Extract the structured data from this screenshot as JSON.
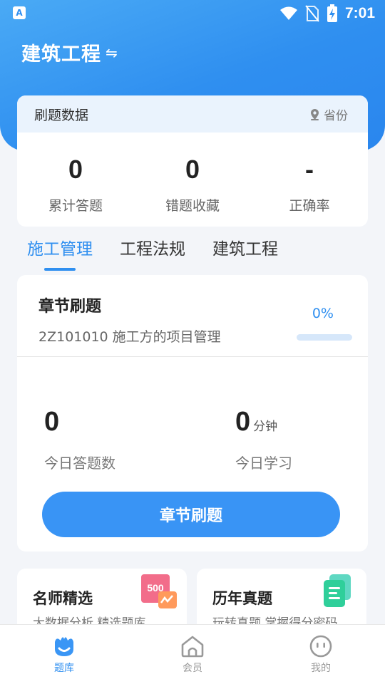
{
  "status_bar": {
    "time": "7:01",
    "app_icon_letter": "A"
  },
  "header": {
    "title": "建筑工程",
    "switch_icon": "swap-arrows-icon"
  },
  "stats": {
    "title": "刷题数据",
    "province_label": "省份",
    "items": [
      {
        "value": "0",
        "label": "累计答题"
      },
      {
        "value": "0",
        "label": "错题收藏"
      },
      {
        "value": "-",
        "label": "正确率"
      }
    ]
  },
  "tabs": [
    {
      "label": "施工管理",
      "active": true
    },
    {
      "label": "工程法规",
      "active": false
    },
    {
      "label": "建筑工程",
      "active": false
    }
  ],
  "chapter": {
    "title": "章节刷题",
    "subtitle": "2Z101010 施工方的项目管理",
    "progress_text": "0%",
    "progress": 0,
    "today_count": "0",
    "today_count_label": "今日答题数",
    "today_study": "0",
    "today_study_unit": "分钟",
    "today_study_label": "今日学习",
    "button_label": "章节刷题"
  },
  "promos": [
    {
      "title": "名师精选",
      "subtitle": "大数据分析 精选题库",
      "badge": "500"
    },
    {
      "title": "历年真题",
      "subtitle": "玩转真题 掌握得分密码"
    }
  ],
  "bottom_nav": [
    {
      "label": "题库",
      "icon": "question-bank-icon",
      "active": true
    },
    {
      "label": "会员",
      "icon": "home-icon",
      "active": false
    },
    {
      "label": "我的",
      "icon": "face-icon",
      "active": false
    }
  ],
  "colors": {
    "primary": "#2f8ff0",
    "button": "#3994f5",
    "background": "#f3f5f9"
  }
}
